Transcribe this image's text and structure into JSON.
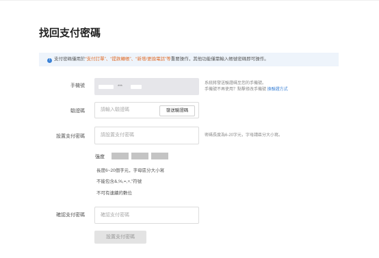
{
  "page": {
    "title": "找回支付密碼"
  },
  "notice": {
    "prefix": "支付密碼僅用於",
    "highlight": "“支付訂單”、“提款轉帳”、“新增/更換電話”等",
    "suffix": "重要操作，其他功能僅需輸入帳號密碼即可操作。"
  },
  "phone": {
    "label": "手機號",
    "value_masked": "***",
    "hint_line1": "系統將發送驗證碼至您的手機號。",
    "hint_line2": "手機號不再使用？點擊修改手機號",
    "hint_link": "換驗證方式"
  },
  "code": {
    "label": "驗證碼",
    "placeholder": "請輸入驗證碼",
    "send_button": "發送驗證碼"
  },
  "set_password": {
    "label": "設置支付密碼",
    "placeholder": "請設置支付密碼",
    "hint": "密碼長度為6-20字元，字母請區分大小寫。",
    "strength_label": "強度",
    "rules": [
      "長度6~20個字元，字母區分大小寫",
      "不能包含&,%,=,+,\"符號",
      "不可有連續的數位"
    ]
  },
  "confirm_password": {
    "label": "確認支付密碼",
    "placeholder": "確認支付密碼"
  },
  "submit": {
    "label": "設置支付密碼"
  },
  "colors": {
    "accent": "#3b82d6",
    "highlight": "#e06c2a",
    "notice_bg": "#eef4fb"
  }
}
